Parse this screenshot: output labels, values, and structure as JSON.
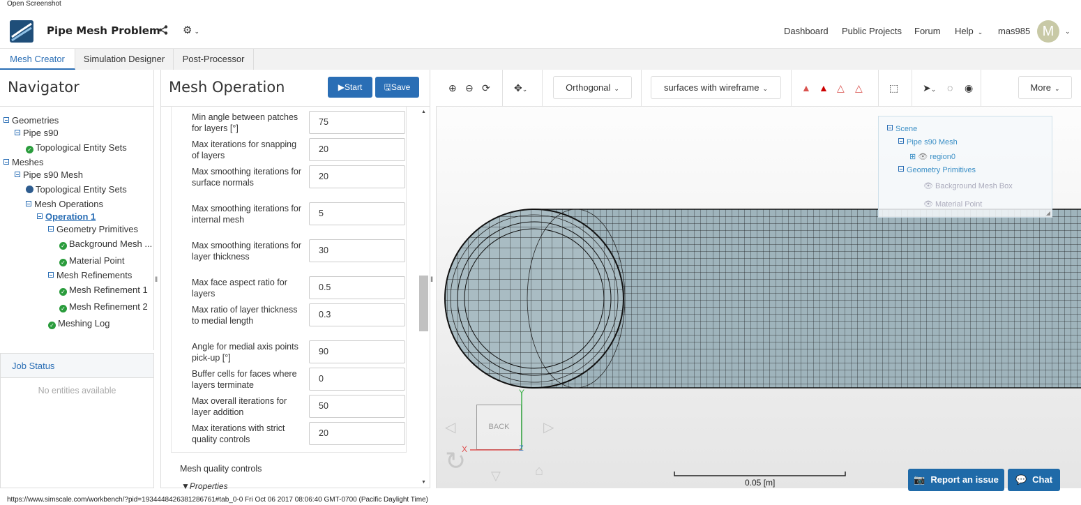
{
  "caption": "Open Screenshot",
  "header": {
    "title": "Pipe Mesh Problem",
    "nav": [
      "Dashboard",
      "Public Projects",
      "Forum",
      "Help",
      "mas985"
    ],
    "avatar_letter": "M"
  },
  "tabs": [
    "Mesh Creator",
    "Simulation Designer",
    "Post-Processor"
  ],
  "navigator": {
    "title": "Navigator",
    "tree": [
      {
        "label": "Geometries"
      },
      {
        "label": "Pipe s90"
      },
      {
        "label": "Topological Entity Sets"
      },
      {
        "label": "Meshes"
      },
      {
        "label": "Pipe s90 Mesh"
      },
      {
        "label": "Topological Entity Sets"
      },
      {
        "label": "Mesh Operations"
      },
      {
        "label": "Operation 1"
      },
      {
        "label": "Geometry Primitives"
      },
      {
        "label": "Background Mesh ..."
      },
      {
        "label": "Material Point"
      },
      {
        "label": "Mesh Refinements"
      },
      {
        "label": "Mesh Refinement 1"
      },
      {
        "label": "Mesh Refinement 2"
      },
      {
        "label": "Meshing Log"
      }
    ]
  },
  "job_status": {
    "title": "Job Status",
    "empty": "No entities available"
  },
  "mesh_operation": {
    "title": "Mesh Operation",
    "start_label": "Start",
    "save_label": "Save",
    "fields": [
      {
        "label": "Min angle between patches for layers [°]",
        "value": "75"
      },
      {
        "label": "Max iterations for snapping of layers",
        "value": "20"
      },
      {
        "label": "Max smoothing iterations for surface normals",
        "value": "20"
      },
      {
        "label": "Max smoothing iterations for internal mesh",
        "value": "5"
      },
      {
        "label": "Max smoothing iterations for layer thickness",
        "value": "30"
      },
      {
        "label": "Max face aspect ratio for layers",
        "value": "0.5"
      },
      {
        "label": "Max ratio of layer thickness to medial length",
        "value": "0.3"
      },
      {
        "label": "Angle for medial axis points pick-up [°]",
        "value": "90"
      },
      {
        "label": "Buffer cells for faces where layers terminate",
        "value": "0"
      },
      {
        "label": "Max overall iterations for layer addition",
        "value": "50"
      },
      {
        "label": "Max iterations with strict quality controls",
        "value": "20"
      }
    ],
    "section_quality": "Mesh quality controls",
    "properties": "Properties"
  },
  "viewer": {
    "projection": "Orthogonal",
    "render_mode": "surfaces with wireframe",
    "more_label": "More",
    "scene": {
      "root": "Scene",
      "mesh": "Pipe s90 Mesh",
      "region": "region0",
      "primitives": "Geometry Primitives",
      "bg_box": "Background Mesh Box",
      "mat_point": "Material Point"
    },
    "view_cube": "BACK",
    "axes": {
      "x": "X",
      "y": "Y",
      "z": "Z"
    },
    "scale_label": "0.05 [m]",
    "report_label": "Report an issue",
    "chat_label": "Chat"
  },
  "statusbar": "https://www.simscale.com/workbench/?pid=1934448426381286761#tab_0-0 Fri Oct 06 2017 08:06:40 GMT-0700 (Pacific Daylight Time)",
  "colors": {
    "accent": "#2a6eb5",
    "mesh": "#9fb4bc",
    "check": "#2a9c3c"
  }
}
